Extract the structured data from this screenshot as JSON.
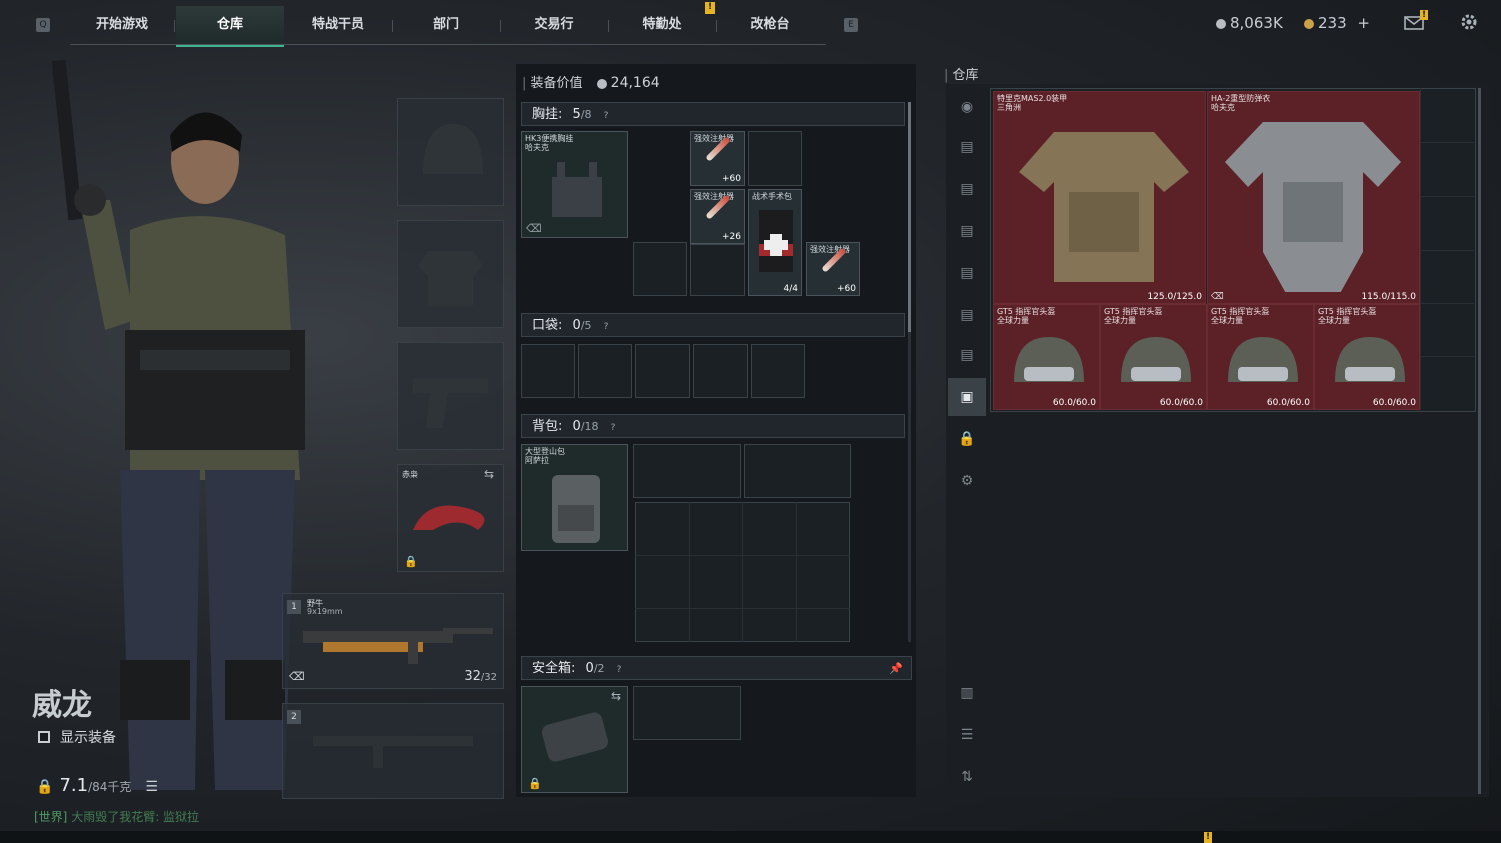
{
  "nav": {
    "left_key": "Q",
    "right_key": "E",
    "tabs": [
      {
        "label": "开始游戏",
        "active": false
      },
      {
        "label": "仓库",
        "active": true
      },
      {
        "label": "特战干员",
        "active": false
      },
      {
        "label": "部门",
        "active": false
      },
      {
        "label": "交易行",
        "active": false
      },
      {
        "label": "特勤处",
        "active": false
      },
      {
        "label": "改枪台",
        "active": false
      }
    ],
    "alert_badge": "!"
  },
  "currency": {
    "silver": "8,063K",
    "gold": "233",
    "add_label": "+",
    "mail_badge": "!"
  },
  "character": {
    "name": "威龙",
    "show_gear_label": "显示装备",
    "weight_value": "7.1",
    "weight_max": "/84千克",
    "chat_channel": "[世界]",
    "chat_message": "大雨毁了我花臂: 监狱拉",
    "slots": {
      "melee_name": "赤枭",
      "weapon1_index": "1",
      "weapon1_name": "野牛",
      "weapon1_caliber": "9x19mm",
      "weapon1_ammo": "32",
      "weapon1_ammo_max": "/32",
      "weapon2_index": "2"
    }
  },
  "equipment": {
    "value_label": "装备价值",
    "value": "24,164",
    "chest_rig": {
      "label": "胸挂:",
      "count": "5",
      "capacity": "/8",
      "item_name": "HK3便携胸挂",
      "item_sub": "哈夫克",
      "items": [
        {
          "name": "强效注射器",
          "qty": "+60"
        },
        {
          "name": "强效注射器",
          "qty": "+26"
        },
        {
          "name": "战术手术包",
          "qty": "4/4"
        },
        {
          "name": "强效注射器",
          "qty": "+60"
        }
      ]
    },
    "pocket": {
      "label": "口袋:",
      "count": "0",
      "capacity": "/5"
    },
    "backpack": {
      "label": "背包:",
      "count": "0",
      "capacity": "/18",
      "item_name": "大型登山包",
      "item_sub": "阿萨拉"
    },
    "safebox": {
      "label": "安全箱:",
      "count": "0",
      "capacity": "/2"
    },
    "help_mark": "?"
  },
  "warehouse": {
    "title": "仓库",
    "items": [
      {
        "name": "特里克MAS2.0装甲",
        "sub": "三角洲",
        "durability": "125.0/125.0"
      },
      {
        "name": "HA-2重型防弹衣",
        "sub": "哈夫克",
        "durability": "115.0/115.0"
      },
      {
        "name": "GT5 指挥官头盔",
        "sub": "全球力量",
        "durability": "60.0/60.0"
      },
      {
        "name": "GT5 指挥官头盔",
        "sub": "全球力量",
        "durability": "60.0/60.0"
      },
      {
        "name": "GT5 指挥官头盔",
        "sub": "全球力量",
        "durability": "60.0/60.0"
      },
      {
        "name": "GT5 指挥官头盔",
        "sub": "全球力量",
        "durability": "60.0/60.0"
      }
    ]
  },
  "colors": {
    "accent": "#3fb58f",
    "warehouse_item_bg": "#5b2127",
    "alert": "#e6b420"
  }
}
